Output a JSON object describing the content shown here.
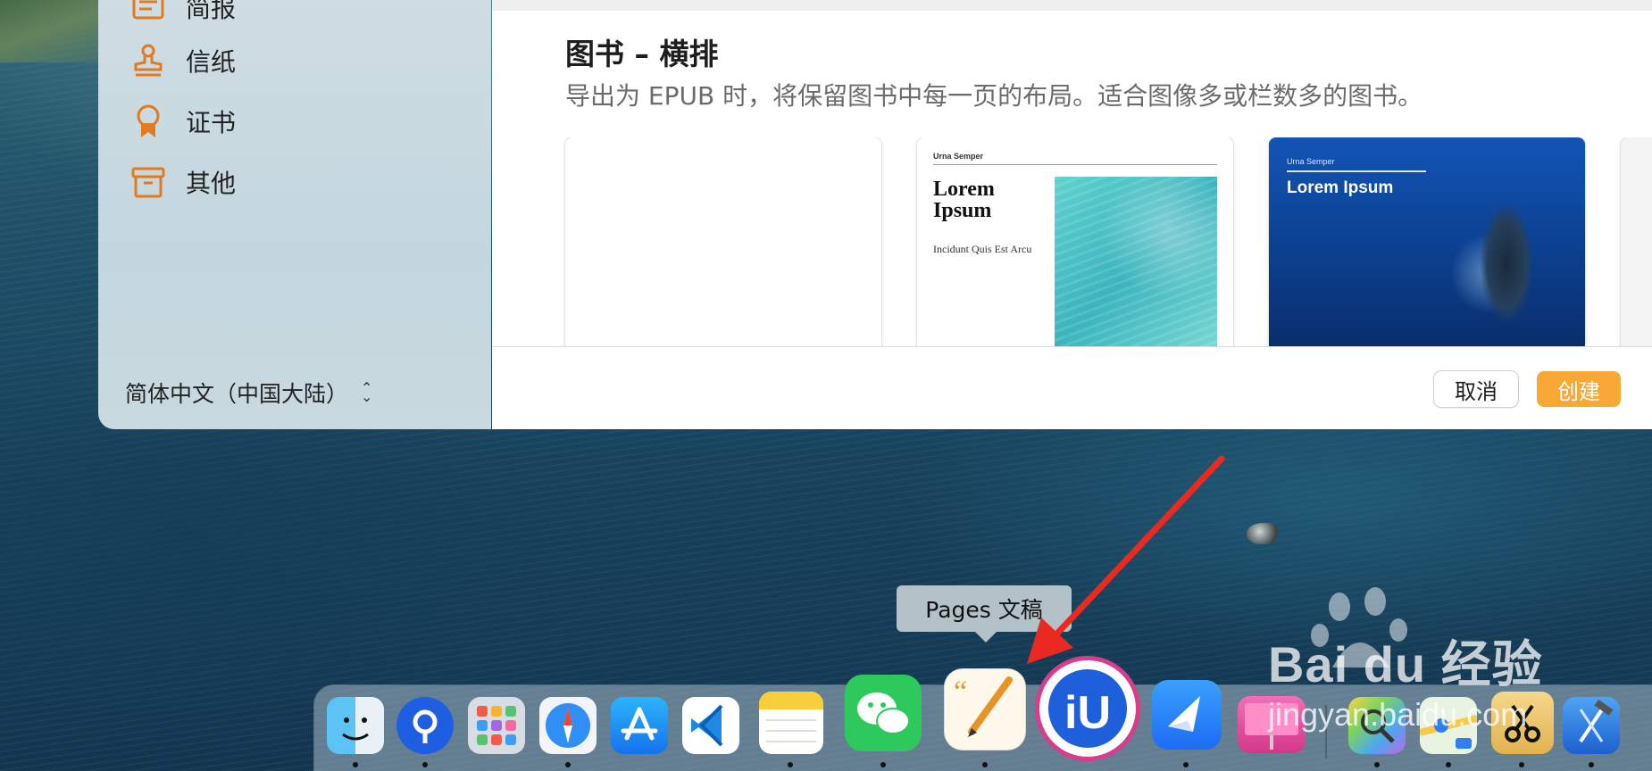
{
  "sidebar": {
    "items": [
      {
        "label": "简报",
        "icon": "newsletter-icon"
      },
      {
        "label": "信纸",
        "icon": "stamp-icon"
      },
      {
        "label": "证书",
        "icon": "ribbon-award-icon"
      },
      {
        "label": "其他",
        "icon": "archive-box-icon"
      }
    ],
    "language": "简体中文（中国大陆）"
  },
  "section": {
    "title": "图书 – 横排",
    "description": "导出为 EPUB 时，将保留图书中每一页的布局。适合图像多或栏数多的图书。"
  },
  "templates": [
    {
      "name": "blank",
      "header": "",
      "title": "",
      "subtitle": ""
    },
    {
      "name": "template-2",
      "header": "Urna Semper",
      "title": "Lorem Ipsum",
      "subtitle": "Incidunt Quis Est Arcu"
    },
    {
      "name": "template-3",
      "header": "Urna Semper",
      "title": "Lorem Ipsum",
      "subtitle": ""
    }
  ],
  "buttons": {
    "cancel": "取消",
    "create": "创建"
  },
  "tooltip": "Pages 文稿",
  "accent_color": "#f7a835",
  "dock": {
    "apps": [
      "finder-icon",
      "pinpoint-icon",
      "launchpad-icon",
      "safari-icon",
      "app-store-icon",
      "vscode-icon",
      "notes-icon",
      "wechat-icon",
      "pages-icon",
      "iu-app-icon",
      "feishu-icon",
      "keynote-icon",
      "color-picker-icon",
      "maps-icon",
      "scissors-app-icon",
      "xcode-icon"
    ]
  },
  "watermark": {
    "brand": "Bai du 经验",
    "url": "jingyan.baidu.com"
  }
}
